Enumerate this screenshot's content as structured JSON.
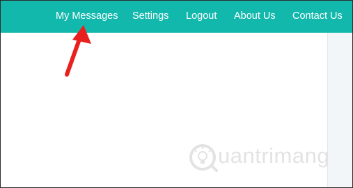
{
  "nav": {
    "items": [
      {
        "label": "My Messages"
      },
      {
        "label": "Settings"
      },
      {
        "label": "Logout"
      },
      {
        "label": "About Us"
      },
      {
        "label": "Contact Us"
      }
    ]
  },
  "colors": {
    "navbar": "#13b8ad",
    "nav_text": "#ffffff",
    "annotation_arrow": "#e8211f",
    "side_panel": "#f3f6f9",
    "watermark": "#e3e3e3"
  },
  "watermark": {
    "text": "uantrimang"
  }
}
